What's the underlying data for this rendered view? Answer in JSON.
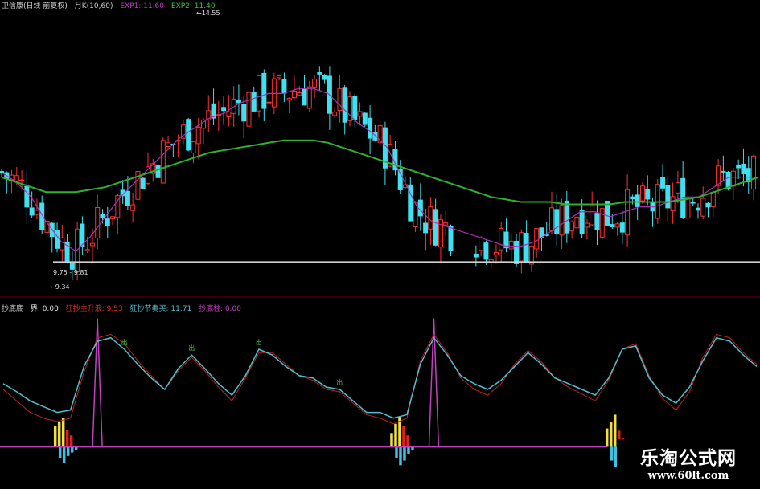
{
  "upper_header": {
    "title": "卫信康(日线 前复权)",
    "indicator": "月K(10,60)",
    "exp1": "EXP1: 11.60",
    "exp2": "EXP2: 11.40",
    "colors": {
      "title": "#d0d0d0",
      "exp1": "#c040c0",
      "exp2": "#40c040"
    }
  },
  "lower_header": {
    "title": "抄底底",
    "v1": "界: 0.00",
    "v2": "狂抄主升浪: 9.53",
    "v3": "狂抄节奏买: 11.71",
    "v4": "抄底柱: 0.00",
    "colors": {
      "v1": "#e0e0e0",
      "v2": "#e03030",
      "v3": "#50c0d0",
      "v4": "#c040c0"
    }
  },
  "chart_data": {
    "type": "line",
    "candlestick_price_panel": {
      "high_marker": "14.55",
      "low_marker": "9.34",
      "range_label": "9.75 - 9.81",
      "colors": {
        "up": "#ff3030",
        "down": "#40e0f0",
        "exp1": "#b030b0",
        "exp2": "#30b030",
        "support": "#d0d0d0"
      },
      "ylim": [
        9.2,
        14.9
      ],
      "support_level": 9.78,
      "series": [
        {
          "name": "EXP1",
          "values": [
            11.6,
            11.4,
            11.1,
            10.6,
            10.2,
            10.0,
            10.3,
            10.7,
            11.1,
            11.4,
            11.7,
            12.0,
            12.3,
            12.5,
            12.7,
            12.8,
            13.0,
            13.1,
            13.2,
            13.2,
            13.3,
            13.3,
            13.2,
            12.9,
            12.6,
            12.4,
            12.1,
            11.5,
            10.9,
            10.6,
            10.5,
            10.4,
            10.3,
            10.2,
            10.1,
            10.1,
            10.2,
            10.4,
            10.6,
            10.8,
            10.8,
            10.7,
            10.8,
            10.9,
            10.9,
            11.0,
            11.1,
            11.1,
            11.3,
            11.5,
            11.5,
            11.5
          ]
        },
        {
          "name": "EXP2",
          "values": [
            11.5,
            11.4,
            11.3,
            11.2,
            11.2,
            11.2,
            11.25,
            11.3,
            11.4,
            11.5,
            11.6,
            11.7,
            11.8,
            11.9,
            12.0,
            12.05,
            12.1,
            12.15,
            12.2,
            12.25,
            12.25,
            12.25,
            12.2,
            12.1,
            12.0,
            11.9,
            11.8,
            11.7,
            11.6,
            11.5,
            11.4,
            11.3,
            11.2,
            11.1,
            11.05,
            11.0,
            11.0,
            11.0,
            10.95,
            10.95,
            10.95,
            10.95,
            11.0,
            11.0,
            11.0,
            11.0,
            11.05,
            11.1,
            11.2,
            11.3,
            11.4,
            11.5
          ]
        }
      ]
    },
    "oscillator_panel": {
      "ylim": [
        -20,
        120
      ],
      "colors": {
        "hist_up": "#f0e040",
        "hist_strong": "#e02020",
        "hist_down": "#40c0e0",
        "zero_line": "#c040c0",
        "fast": "#50c0d0",
        "slow": "#c02020",
        "spike": "#c040c0"
      },
      "fast": [
        55,
        48,
        40,
        35,
        30,
        32,
        70,
        92,
        95,
        85,
        72,
        60,
        50,
        68,
        80,
        68,
        55,
        45,
        62,
        85,
        80,
        70,
        62,
        60,
        52,
        50,
        40,
        30,
        30,
        25,
        28,
        72,
        95,
        80,
        62,
        55,
        50,
        58,
        70,
        82,
        72,
        60,
        55,
        50,
        45,
        60,
        85,
        88,
        60,
        45,
        38,
        52,
        75,
        95,
        92,
        80,
        70
      ],
      "slow": [
        50,
        40,
        30,
        25,
        22,
        25,
        65,
        95,
        98,
        90,
        75,
        62,
        50,
        66,
        78,
        66,
        52,
        40,
        60,
        82,
        82,
        72,
        62,
        58,
        50,
        48,
        38,
        28,
        25,
        20,
        25,
        75,
        98,
        82,
        60,
        50,
        45,
        55,
        72,
        84,
        74,
        60,
        52,
        46,
        40,
        58,
        85,
        90,
        62,
        42,
        32,
        48,
        78,
        98,
        95,
        82,
        72
      ],
      "spike_indices": [
        7,
        32
      ],
      "histogram_groups": [
        {
          "start": 4,
          "up": [
            18,
            22,
            25,
            15,
            10
          ],
          "down": [
            -10,
            -14,
            -8,
            -5,
            -3
          ]
        },
        {
          "start": 29,
          "up": [
            12,
            20,
            26,
            18,
            10
          ],
          "down": [
            -10,
            -16,
            -12,
            -6,
            -3
          ]
        },
        {
          "start": 45,
          "up": [
            16,
            22,
            28,
            14,
            8
          ],
          "down": [
            -12,
            -18,
            -10,
            -5,
            -2
          ]
        }
      ],
      "labels": [
        "出",
        "出",
        "出",
        "出"
      ]
    }
  },
  "watermark": {
    "line1": "乐淘公式网",
    "line2": "www.60lt.com"
  }
}
